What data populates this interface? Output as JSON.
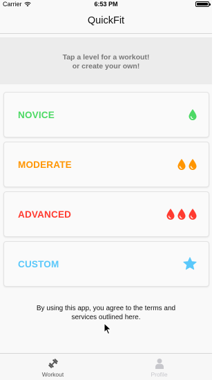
{
  "status_bar": {
    "carrier": "Carrier",
    "time": "6:53 PM",
    "wifi_icon": "wifi-icon",
    "battery_icon": "battery-icon"
  },
  "nav": {
    "title": "QuickFit"
  },
  "banner": {
    "text": "Tap a level for a workout!\nor create your own!"
  },
  "levels": [
    {
      "label": "NOVICE",
      "color": "#4cd964",
      "icon": "drop-icon",
      "icon_count": 1
    },
    {
      "label": "MODERATE",
      "color": "#ff9500",
      "icon": "drop-icon",
      "icon_count": 2
    },
    {
      "label": "ADVANCED",
      "color": "#ff3b30",
      "icon": "drop-icon",
      "icon_count": 3
    },
    {
      "label": "CUSTOM",
      "color": "#5ac8fa",
      "icon": "star-icon",
      "icon_count": 1
    }
  ],
  "terms": {
    "text": "By using this app, you agree to the terms and\nservices outlined here."
  },
  "tab_bar": {
    "tabs": [
      {
        "label": "Workout",
        "icon": "dumbbell-icon",
        "selected": true,
        "color": "#555555"
      },
      {
        "label": "Profile",
        "icon": "person-icon",
        "selected": false,
        "color": "#c7c7cc"
      }
    ]
  }
}
